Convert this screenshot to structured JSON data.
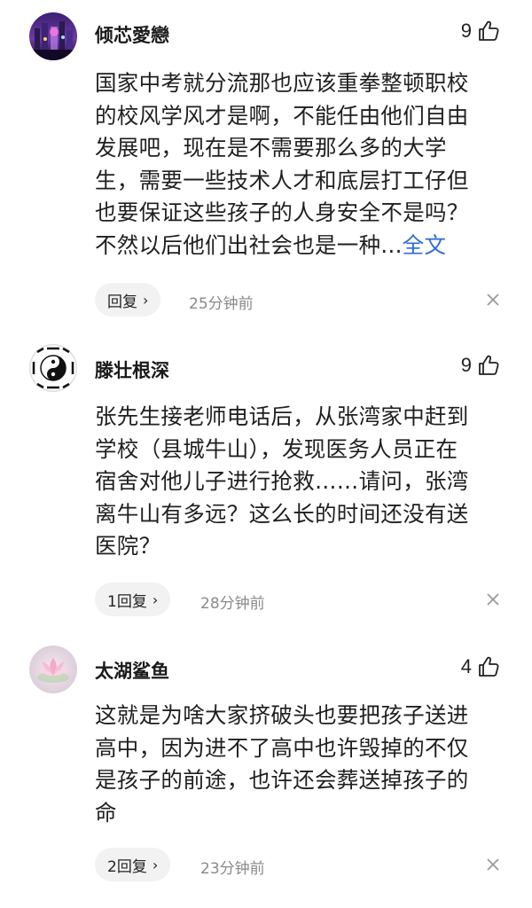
{
  "comments": [
    {
      "username": "倾芯愛戀",
      "likes": "9",
      "lines": [
        "国家中考就分流那也应该重拳整顿职校",
        "的校风学风才是啊，不能任由他们自由",
        "发展吧，现在是不需要那么多的大学",
        "生，需要一些技术人才和底层打工仔但",
        "也要保证这些孩子的人身安全不是吗？",
        "不然以后他们出社会也是一种..."
      ],
      "more_label": "全文",
      "reply_label": "回复",
      "time": "25分钟前",
      "avatar_icon": "city-night-avatar"
    },
    {
      "username": "滕壮根深",
      "likes": "9",
      "lines": [
        "张先生接老师电话后，从张湾家中赶到",
        "学校（县城牛山），发现医务人员正在",
        "宿舍对他儿子进行抢救……请问，张湾",
        "离牛山有多远？这么长的时间还没有送",
        "医院？"
      ],
      "reply_label": "1回复",
      "time": "28分钟前",
      "avatar_icon": "yin-yang-bagua-avatar"
    },
    {
      "username": "太湖鲨鱼",
      "likes": "4",
      "lines": [
        "这就是为啥大家挤破头也要把孩子送进",
        "高中，因为进不了高中也许毁掉的不仅",
        "是孩子的前途，也许还会葬送掉孩子的",
        "命"
      ],
      "reply_label": "2回复",
      "time": "23分钟前",
      "avatar_icon": "lotus-flower-avatar"
    }
  ],
  "colors": {
    "link": "#2f6bd8",
    "muted": "#8a8a8a",
    "pill": "#f2f2f2"
  }
}
